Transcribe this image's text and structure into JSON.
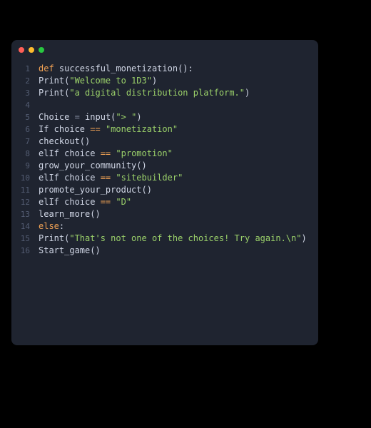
{
  "colors": {
    "background": "#000000",
    "editor_bg": "#1f2430",
    "gutter": "#545d73",
    "text": "#d1d7e6",
    "keyword": "#f3a355",
    "string": "#9bd16a",
    "titlebar_red": "#ff5f57",
    "titlebar_yellow": "#febc2e",
    "titlebar_green": "#28c840"
  },
  "lines": {
    "l1": {
      "num": "1",
      "kw": "def ",
      "name": "successful_monetization",
      "paren": "():"
    },
    "l2": {
      "num": "2",
      "call": "Print(",
      "str": "\"Welcome to 1D3\"",
      "close": ")"
    },
    "l3": {
      "num": "3",
      "call": "Print(",
      "str": "\"a digital distribution platform.\"",
      "close": ")"
    },
    "l4": {
      "num": "4"
    },
    "l5": {
      "num": "5",
      "lhs": "Choice ",
      "eq": "=",
      "sp": " ",
      "fn": "input",
      "open": "(",
      "str": "\"> \"",
      "close": ")"
    },
    "l6": {
      "num": "6",
      "kw": "If choice ",
      "op": "==",
      "sp": " ",
      "str": "\"monetization\""
    },
    "l7": {
      "num": "7",
      "call": "checkout()"
    },
    "l8": {
      "num": "8",
      "kw": "elIf choice ",
      "op": "==",
      "sp": " ",
      "str": "\"promotion\""
    },
    "l9": {
      "num": "9",
      "call": "grow_your_community()"
    },
    "l10": {
      "num": "10",
      "kw": "elIf choice ",
      "op": "==",
      "sp": " ",
      "str": "\"sitebuilder\""
    },
    "l11": {
      "num": "11",
      "call": "promote_your_product()"
    },
    "l12": {
      "num": "12",
      "kw": "elIf choice ",
      "op": "==",
      "sp": " ",
      "str": "\"D\""
    },
    "l13": {
      "num": "13",
      "call": "learn_more()"
    },
    "l14": {
      "num": "14",
      "kw": "else",
      "colon": ":"
    },
    "l15": {
      "num": "15",
      "call": "Print(",
      "str": "\"That's not one of the choices! Try again.\\n\"",
      "close": ")"
    },
    "l16": {
      "num": "16",
      "call": "Start_game()"
    }
  }
}
